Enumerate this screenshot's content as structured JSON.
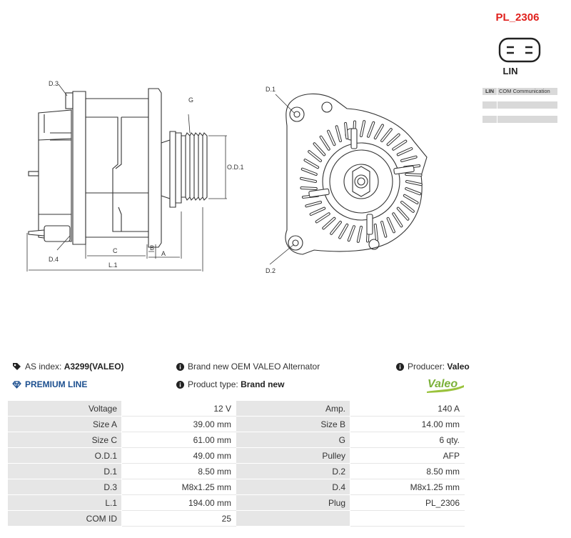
{
  "plug": {
    "code": "PL_2306",
    "type": "LIN",
    "pins": [
      {
        "key": "LIN",
        "value": "COM Communication"
      },
      {
        "key": "",
        "value": ""
      },
      {
        "key": "",
        "value": ""
      }
    ]
  },
  "drawing": {
    "labels": {
      "d3": "D.3",
      "g": "G",
      "od1": "O.D.1",
      "d4": "D.4",
      "c": "C",
      "b": "B",
      "a": "A",
      "l1": "L.1",
      "d1": "D.1",
      "d2": "D.2"
    }
  },
  "info": {
    "as_index_label": "AS index:",
    "as_index_value": "A3299(VALEO)",
    "premium_line": "PREMIUM LINE",
    "description": "Brand new OEM VALEO Alternator",
    "product_type_label": "Product type:",
    "product_type_value": "Brand new",
    "producer_label": "Producer:",
    "producer_value": "Valeo",
    "logo_text": "Valeo"
  },
  "specs": [
    [
      "Voltage",
      "12 V",
      "Amp.",
      "140 A"
    ],
    [
      "Size A",
      "39.00 mm",
      "Size B",
      "14.00 mm"
    ],
    [
      "Size C",
      "61.00 mm",
      "G",
      "6 qty."
    ],
    [
      "O.D.1",
      "49.00 mm",
      "Pulley",
      "AFP"
    ],
    [
      "D.1",
      "8.50 mm",
      "D.2",
      "8.50 mm"
    ],
    [
      "D.3",
      "M8x1.25 mm",
      "D.4",
      "M8x1.25 mm"
    ],
    [
      "L.1",
      "194.00 mm",
      "Plug",
      "PL_2306"
    ],
    [
      "COM ID",
      "25",
      "",
      ""
    ]
  ]
}
